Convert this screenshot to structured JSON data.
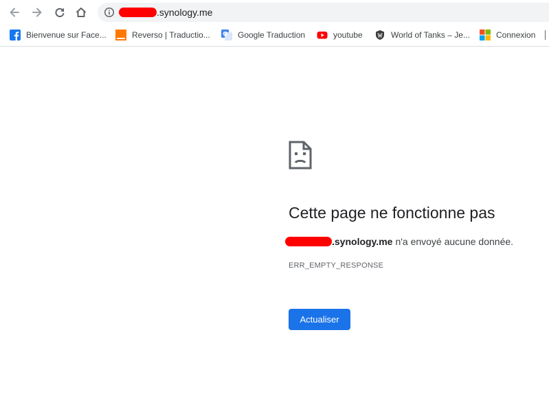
{
  "toolbar": {
    "back_icon": "arrow-left-icon",
    "forward_icon": "arrow-right-icon",
    "reload_icon": "reload-icon",
    "home_icon": "home-icon"
  },
  "omnibox": {
    "info_icon": "info-icon",
    "url_suffix": ".synology.me"
  },
  "bookmarks": [
    {
      "label": "Bienvenue sur Face...",
      "icon": "facebook-icon"
    },
    {
      "label": "Reverso | Traductio...",
      "icon": "reverso-icon"
    },
    {
      "label": "Google Traduction",
      "icon": "google-translate-icon"
    },
    {
      "label": "youtube",
      "icon": "youtube-icon"
    },
    {
      "label": "World of Tanks – Je...",
      "icon": "world-of-tanks-icon"
    },
    {
      "label": "Connexion",
      "icon": "microsoft-icon"
    }
  ],
  "error": {
    "icon": "sad-page-icon",
    "title": "Cette page ne fonctionne pas",
    "host": ".synology.me",
    "message": "n'a envoyé aucune donnée.",
    "code": "ERR_EMPTY_RESPONSE",
    "reload_label": "Actualiser"
  },
  "colors": {
    "accent": "#1a73e8",
    "omnibox_bg": "#f1f3f4",
    "redaction": "#ff0000"
  }
}
